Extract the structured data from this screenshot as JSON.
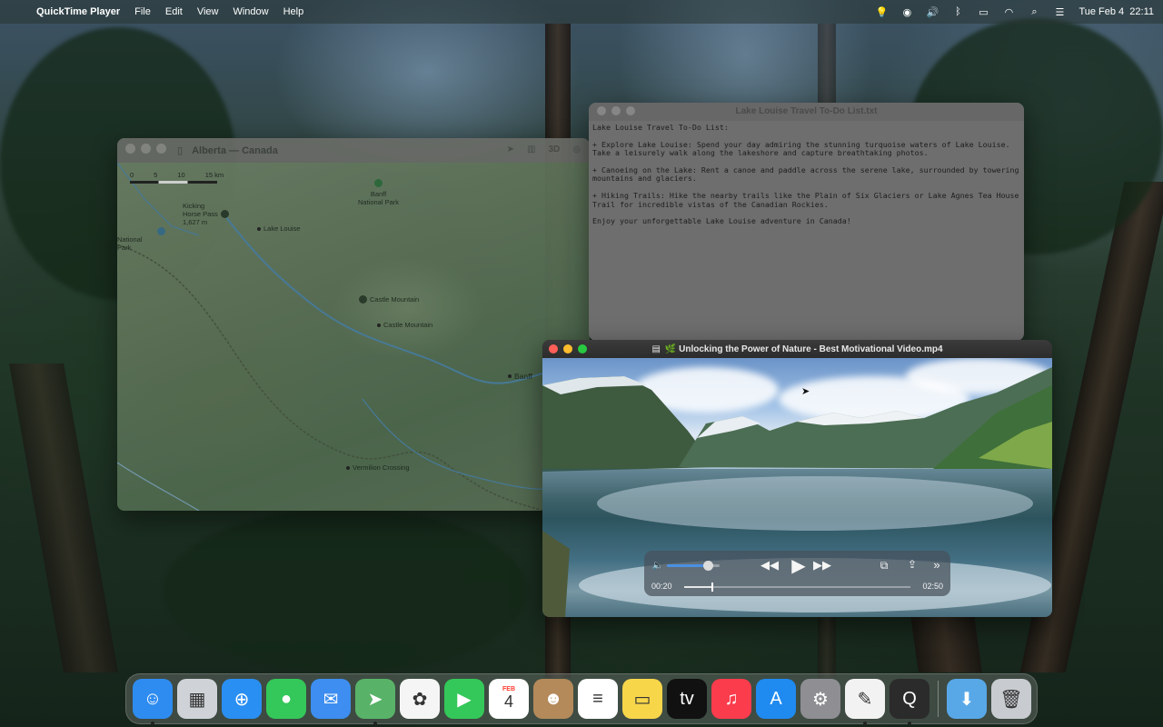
{
  "menubar": {
    "app_name": "QuickTime Player",
    "items": [
      "File",
      "Edit",
      "View",
      "Window",
      "Help"
    ],
    "datetime": "Tue Feb 4  22:11"
  },
  "maps_window": {
    "title": "Alberta — Canada",
    "toolbar_3d": "3D",
    "scale": [
      "0",
      "5",
      "10",
      "15 km"
    ],
    "labels": {
      "banff_np": "Banff\nNational Park",
      "kicking_horse": "Kicking\nHorse Pass\n1,627 m",
      "lake_louise": "Lake Louise",
      "national_park": "National\nPark",
      "castle_mountain_peak": "Castle Mountain",
      "castle_mountain": "Castle Mountain",
      "banff": "Banff",
      "vermilion": "Vermilion Crossing"
    }
  },
  "text_window": {
    "title": "Lake Louise Travel To-Do List.txt",
    "content": "Lake Louise Travel To-Do List:\n\n+ Explore Lake Louise: Spend your day admiring the stunning turquoise waters of Lake Louise.\nTake a leisurely walk along the lakeshore and capture breathtaking photos.\n\n+ Canoeing on the Lake: Rent a canoe and paddle across the serene lake, surrounded by towering\nmountains and glaciers.\n\n+ Hiking Trails: Hike the nearby trails like the Plain of Six Glaciers or Lake Agnes Tea House\nTrail for incredible vistas of the Canadian Rockies.\n\nEnjoy your unforgettable Lake Louise adventure in Canada!"
  },
  "quicktime_window": {
    "title": "🌿 Unlocking the Power of Nature - Best Motivational Video.mp4",
    "current_time": "00:20",
    "duration": "02:50",
    "progress": 0.12,
    "volume": 0.78
  },
  "dock": {
    "apps": [
      {
        "name": "finder",
        "glyph": "☺",
        "color": "#2e8cf0",
        "running": true
      },
      {
        "name": "launchpad",
        "glyph": "▦",
        "color": "#cfd3d8",
        "running": false
      },
      {
        "name": "safari",
        "glyph": "⊕",
        "color": "#2a8ff2",
        "running": false
      },
      {
        "name": "messages",
        "glyph": "●",
        "color": "#34c759",
        "running": false
      },
      {
        "name": "mail",
        "glyph": "✉",
        "color": "#3d8ef0",
        "running": false
      },
      {
        "name": "maps",
        "glyph": "➤",
        "color": "#58b368",
        "running": true
      },
      {
        "name": "photos",
        "glyph": "✿",
        "color": "#f5f5f5",
        "running": false
      },
      {
        "name": "facetime",
        "glyph": "▶",
        "color": "#34c759",
        "running": false
      },
      {
        "name": "calendar",
        "glyph": "4",
        "color": "#ffffff",
        "running": false,
        "month": "FEB"
      },
      {
        "name": "contacts",
        "glyph": "☻",
        "color": "#b48a5a",
        "running": false
      },
      {
        "name": "reminders",
        "glyph": "≡",
        "color": "#ffffff",
        "running": false
      },
      {
        "name": "notes",
        "glyph": "▭",
        "color": "#f7d64a",
        "running": false
      },
      {
        "name": "apple-tv",
        "glyph": "tv",
        "color": "#111111",
        "running": false
      },
      {
        "name": "music",
        "glyph": "♫",
        "color": "#fa3c4c",
        "running": false
      },
      {
        "name": "app-store",
        "glyph": "A",
        "color": "#1f8af0",
        "running": false
      },
      {
        "name": "system-settings",
        "glyph": "⚙",
        "color": "#8e8e93",
        "running": false
      },
      {
        "name": "textedit",
        "glyph": "✎",
        "color": "#f2f2f2",
        "running": true
      },
      {
        "name": "quicktime",
        "glyph": "Q",
        "color": "#2b2b2b",
        "running": true
      }
    ],
    "right": [
      {
        "name": "downloads",
        "glyph": "⬇",
        "color": "#58a8e8"
      },
      {
        "name": "trash",
        "glyph": "🗑",
        "color": "#c8ccd0"
      }
    ]
  }
}
